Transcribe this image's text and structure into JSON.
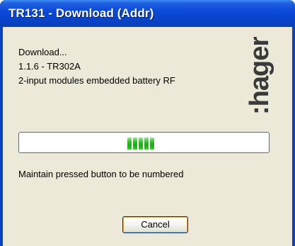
{
  "window": {
    "title": "TR131 - Download (Addr)"
  },
  "info": {
    "line1": "Download...",
    "line2": "1.1.6 - TR302A",
    "line3": "2-input modules embedded battery RF"
  },
  "logo": {
    "text": ":hager",
    "icon": "hager-logo"
  },
  "progress": {
    "style": "marquee",
    "visible_blocks": 5,
    "block_color": "#2fb526"
  },
  "status": {
    "message": "Maintain pressed button to be numbered"
  },
  "buttons": {
    "cancel_label": "Cancel"
  },
  "colors": {
    "titlebar": "#0a48d8",
    "dialog_background": "#ece9d8",
    "button_focus_border": "#e8ad52"
  }
}
